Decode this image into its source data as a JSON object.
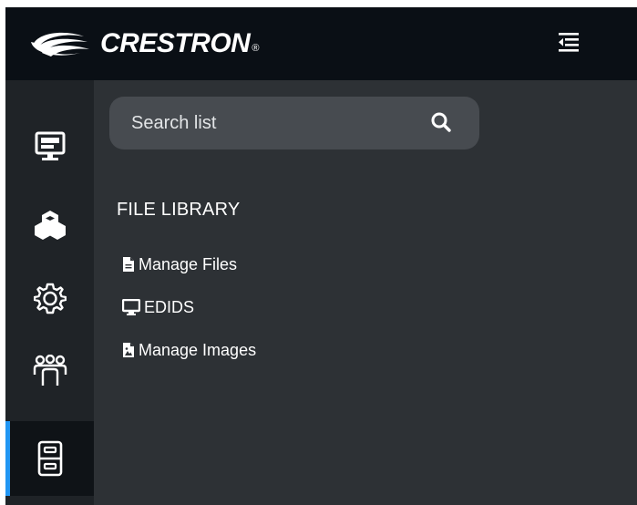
{
  "header": {
    "brand": "CRESTRON",
    "brand_mark": "®",
    "collapse_icon": "collapse-menu-icon"
  },
  "rail": {
    "items": [
      {
        "name": "displays",
        "icon": "monitor-icon"
      },
      {
        "name": "devices",
        "icon": "cubes-icon"
      },
      {
        "name": "settings",
        "icon": "gear-icon"
      },
      {
        "name": "users",
        "icon": "group-icon"
      },
      {
        "name": "file-library",
        "icon": "file-cabinet-icon",
        "active": true
      }
    ]
  },
  "search": {
    "placeholder": "Search list",
    "value": ""
  },
  "section": {
    "title": "FILE LIBRARY",
    "items": [
      {
        "label": "Manage Files",
        "icon": "file-icon"
      },
      {
        "label": "EDIDS",
        "icon": "monitor-icon"
      },
      {
        "label": "Manage Images",
        "icon": "image-file-icon"
      }
    ]
  },
  "colors": {
    "header_bg": "#0a0f15",
    "rail_bg": "#1f2327",
    "panel_bg": "#2d3135",
    "accent": "#2196f3"
  }
}
